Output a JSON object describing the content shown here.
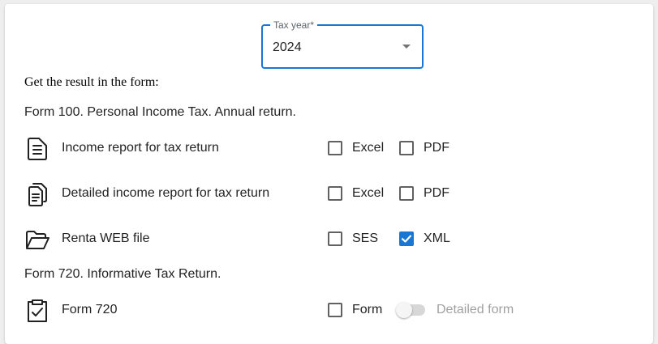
{
  "tax_year": {
    "label": "Tax year*",
    "value": "2024"
  },
  "intro_text": "Get the result in the form:",
  "form100": {
    "title": "Form 100. Personal Income Tax. Annual return.",
    "rows": [
      {
        "icon": "document-icon",
        "label": "Income report for tax return",
        "options": [
          {
            "label": "Excel",
            "checked": false
          },
          {
            "label": "PDF",
            "checked": false
          }
        ]
      },
      {
        "icon": "documents-copy-icon",
        "label": "Detailed income report for tax return",
        "options": [
          {
            "label": "Excel",
            "checked": false
          },
          {
            "label": "PDF",
            "checked": false
          }
        ]
      },
      {
        "icon": "folder-open-icon",
        "label": "Renta WEB file",
        "options": [
          {
            "label": "SES",
            "checked": false
          },
          {
            "label": "XML",
            "checked": true
          }
        ]
      }
    ]
  },
  "form720": {
    "title": "Form 720. Informative Tax Return.",
    "row": {
      "icon": "clipboard-check-icon",
      "label": "Form 720",
      "option": {
        "label": "Form",
        "checked": false
      },
      "toggle": {
        "label": "Detailed form",
        "on": false,
        "disabled": true
      }
    }
  },
  "colors": {
    "accent": "#1976d2",
    "text": "#212121",
    "disabled": "#9e9e9e"
  }
}
